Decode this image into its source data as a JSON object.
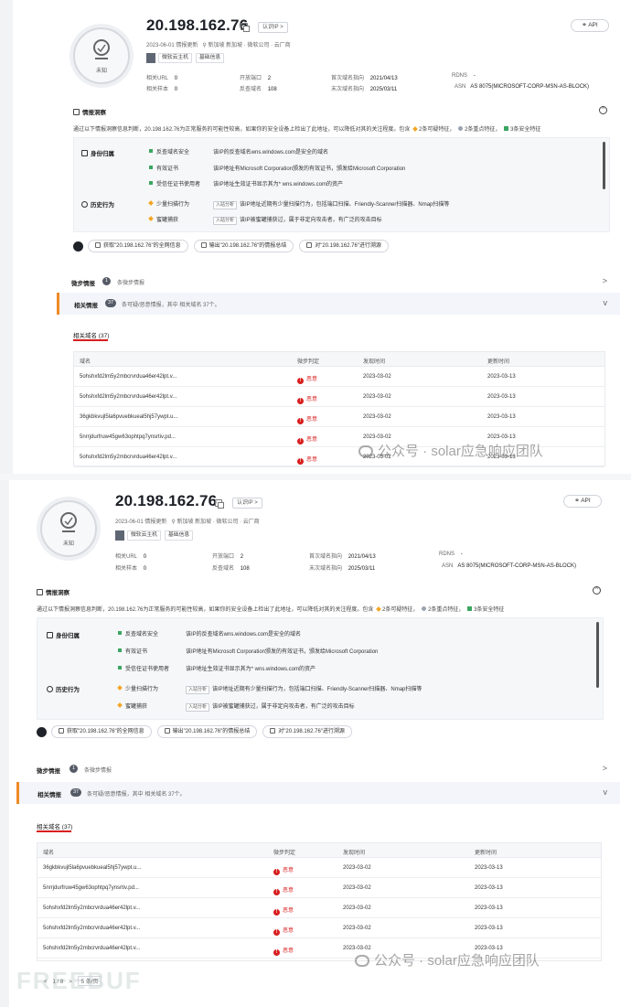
{
  "shared": {
    "ip": "20.198.162.76",
    "identify_label": "认识IP >",
    "api_label": "API",
    "avatar_label": "未知",
    "updated": "2023-06-01 情报更新",
    "location": "新加坡 新加坡 · 微软公司 · 云厂商",
    "tags": [
      "微软云主机",
      "基础信息"
    ],
    "stats": {
      "related_url_label": "相关URL",
      "related_url": "0",
      "open_ports_label": "开放端口",
      "open_ports": "2",
      "first_seen_label": "首次域名指向",
      "first_seen": "2021/04/13",
      "rdns_label": "RDNS",
      "rdns": "-",
      "related_samples_label": "相关样本",
      "related_samples": "0",
      "reverse_domains_label": "反查域名",
      "reverse_domains": "108",
      "last_seen_label": "末次域名指向",
      "last_seen": "2025/03/11",
      "asn_label": "ASN",
      "asn": "AS 8075(MICROSOFT-CORP-MSN-AS-BLOCK)"
    },
    "insight_title": "情报洞察",
    "collapse_symbol": "^",
    "summary_main": "通过以下情报洞察信息判断，20.198.162.76为正常服务的可能性较高，如果你的安全设备上检出了此地址，可以降低对其的关注程度。包含",
    "summary_doubt": "2条可疑特征，",
    "summary_neutral": "2条重点特征，",
    "summary_safe": "3条安全特征",
    "identity_label": "身份归属",
    "history_label": "历史行为",
    "intel_rows": [
      {
        "name": "反查域名安全",
        "desc": "该IP的反查域名wns.windows.com是安全的域名",
        "pill": ""
      },
      {
        "name": "有效证书",
        "desc": "该IP地址有Microsoft Corporation颁发的有效证书，颁发给Microsoft Corporation",
        "pill": ""
      },
      {
        "name": "受信任证书使用者",
        "desc": "该IP地址生效证书显示其为* wns.windows.com的资产",
        "pill": ""
      },
      {
        "name": "少量扫描行为",
        "desc": "该IP地址近期有少量扫描行为，包括端口扫描、Friendly-Scanner扫描器、Nmap扫描等",
        "pill": "入站分析"
      },
      {
        "name": "蜜罐捕获",
        "desc": "该IP被蜜罐捕获过，属于非定向攻击者，有广泛的攻击目标",
        "pill": "入站分析"
      }
    ],
    "actions": [
      "获取\"20.198.162.76\"的全网信息",
      "输出\"20.198.162.76\"的情报总结",
      "对\"20.198.162.76\"进行溯源"
    ],
    "strip1_title": "微步情报",
    "strip1_badge": "1",
    "strip1_text": "条微步情报",
    "strip2_title": "相关情报",
    "strip2_badge": "37",
    "strip2_text": "条可疑/恶意情报，其中 相关域名 37个。",
    "chev_right": ">",
    "chev_down": "v",
    "tab_label": "相关域名 (37)",
    "columns": [
      "域名",
      "微步判定",
      "发现时间",
      "更新时间"
    ],
    "watermark": "公众号 · solar应急响应团队"
  },
  "panel1_rows": [
    {
      "domain": "5ohshxfd2lm5y2mbcrvrdua46er42lpt.v...",
      "verdict": "恶意",
      "found": "2023-03-02",
      "updated": "2023-03-13"
    },
    {
      "domain": "5ohshxfd2lm5y2mbcrvrdua46er42lpt.v...",
      "verdict": "恶意",
      "found": "2023-03-02",
      "updated": "2023-03-13"
    },
    {
      "domain": "36gkbkvujl5la6pvuebkueal5hj57ywpt.u...",
      "verdict": "恶意",
      "found": "2023-03-02",
      "updated": "2023-03-13"
    },
    {
      "domain": "5nrrjdurfruw45gw63ophtpq7ynsrtiv.pd...",
      "verdict": "恶意",
      "found": "2023-03-02",
      "updated": "2023-03-13"
    },
    {
      "domain": "5ohshxfd2lm5y2mbcrvrdua46er42lpt.v...",
      "verdict": "恶意",
      "found": "2023-03-02",
      "updated": "2023-03-13"
    }
  ],
  "panel2_rows": [
    {
      "domain": "36gkbkvujl5la6pvuebkueal5hj57ywpt.u...",
      "verdict": "恶意",
      "found": "2023-03-02",
      "updated": "2023-03-13"
    },
    {
      "domain": "5nrrjdurfruw45gw63ophtpq7ynsrtiv.pd...",
      "verdict": "恶意",
      "found": "2023-03-02",
      "updated": "2023-03-13"
    },
    {
      "domain": "5ohshxfd2lm5y2mbcrvrdua46er42lpt.v...",
      "verdict": "恶意",
      "found": "2023-03-02",
      "updated": "2023-03-13"
    },
    {
      "domain": "5ohshxfd2lm5y2mbcrvrdua46er42lpt.v...",
      "verdict": "恶意",
      "found": "2023-03-02",
      "updated": "2023-03-13"
    },
    {
      "domain": "5ohshxfd2lm5y2mbcrvrdua46er42lpt.v...",
      "verdict": "恶意",
      "found": "2023-03-02",
      "updated": "2023-03-13"
    }
  ],
  "pager": {
    "range": "1 / 8",
    "size": "5 条/页"
  },
  "freebuf": "FREEBUF",
  "colors": {
    "accent_red": "#d81e1e",
    "accent_orange": "#f08a24",
    "safe_green": "#3aa661",
    "doubt_orange": "#f4a623"
  }
}
